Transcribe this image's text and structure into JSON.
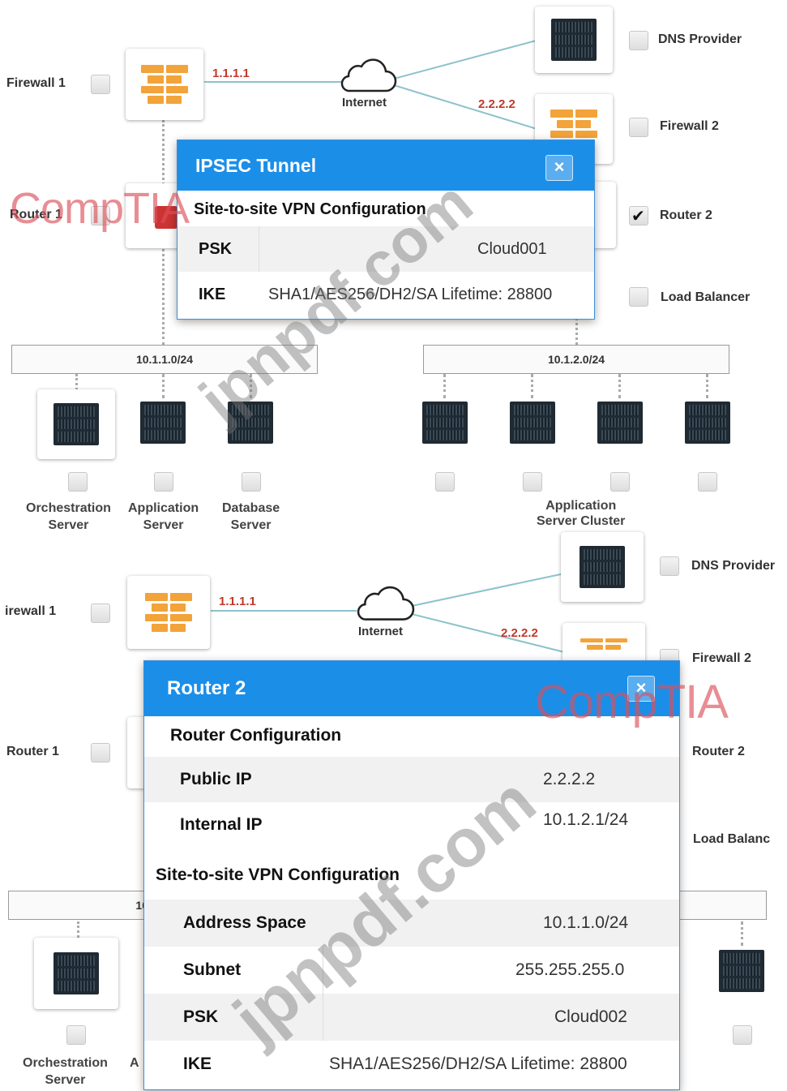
{
  "top": {
    "firewall1_label": "Firewall 1",
    "router1_label": "Router 1",
    "internet_label": "Internet",
    "dns_label": "DNS Provider",
    "firewall2_label": "Firewall 2",
    "router2_label": "Router 2",
    "load_balancer_label": "Load Balancer",
    "ip_firewall1": "1.1.1.1",
    "ip_firewall2": "2.2.2.2",
    "subnet_left": "10.1.1.0/24",
    "subnet_right": "10.1.2.0/24",
    "orchestration_label_1": "Orchestration",
    "orchestration_label_2": "Server",
    "app_server_label_1": "Application",
    "app_server_label_2": "Server",
    "db_label_1": "Database",
    "db_label_2": "Server",
    "cluster_label_1": "Application",
    "cluster_label_2": "Server Cluster",
    "router2_checked": true,
    "dialog": {
      "title": "IPSEC Tunnel",
      "close": "×",
      "section": "Site-to-site VPN Configuration",
      "psk_key": "PSK",
      "psk_value": "Cloud001",
      "ike_key": "IKE",
      "ike_value": "SHA1/AES256/DH2/SA Lifetime: 28800"
    }
  },
  "bottom": {
    "firewall1_label": "irewall 1",
    "router1_label": "Router 1",
    "internet_label": "Internet",
    "dns_label": "DNS Provider",
    "firewall2_label": "Firewall 2",
    "router2_label": "Router 2",
    "load_balancer_label": "Load Balanc",
    "ip_firewall1": "1.1.1.1",
    "ip_firewall2": "2.2.2.2",
    "subnet_left_partial": "10",
    "orchestration_label_1": "Orchestration",
    "orchestration_label_2": "Server",
    "app_partial": "A",
    "dialog": {
      "title": "Router 2",
      "close": "×",
      "router_section": "Router Configuration",
      "public_ip_key": "Public IP",
      "public_ip_value": "2.2.2.2",
      "internal_ip_key": "Internal IP",
      "internal_ip_value": "10.1.2.1/24",
      "vpn_section": "Site-to-site VPN Configuration",
      "address_space_key": "Address Space",
      "address_space_value": "10.1.1.0/24",
      "subnet_key": "Subnet",
      "subnet_value": "255.255.255.0",
      "psk_key": "PSK",
      "psk_value": "Cloud002",
      "ike_key": "IKE",
      "ike_value": "SHA1/AES256/DH2/SA Lifetime: 28800"
    }
  },
  "watermarks": {
    "comptia": "CompTIA",
    "jpnpdf": "jpnpdf.com"
  },
  "colors": {
    "dialog_header": "#1b8ee8",
    "firewall": "#f2a33a",
    "link_line": "#8cc2cc",
    "ip_label": "#c0392b"
  }
}
